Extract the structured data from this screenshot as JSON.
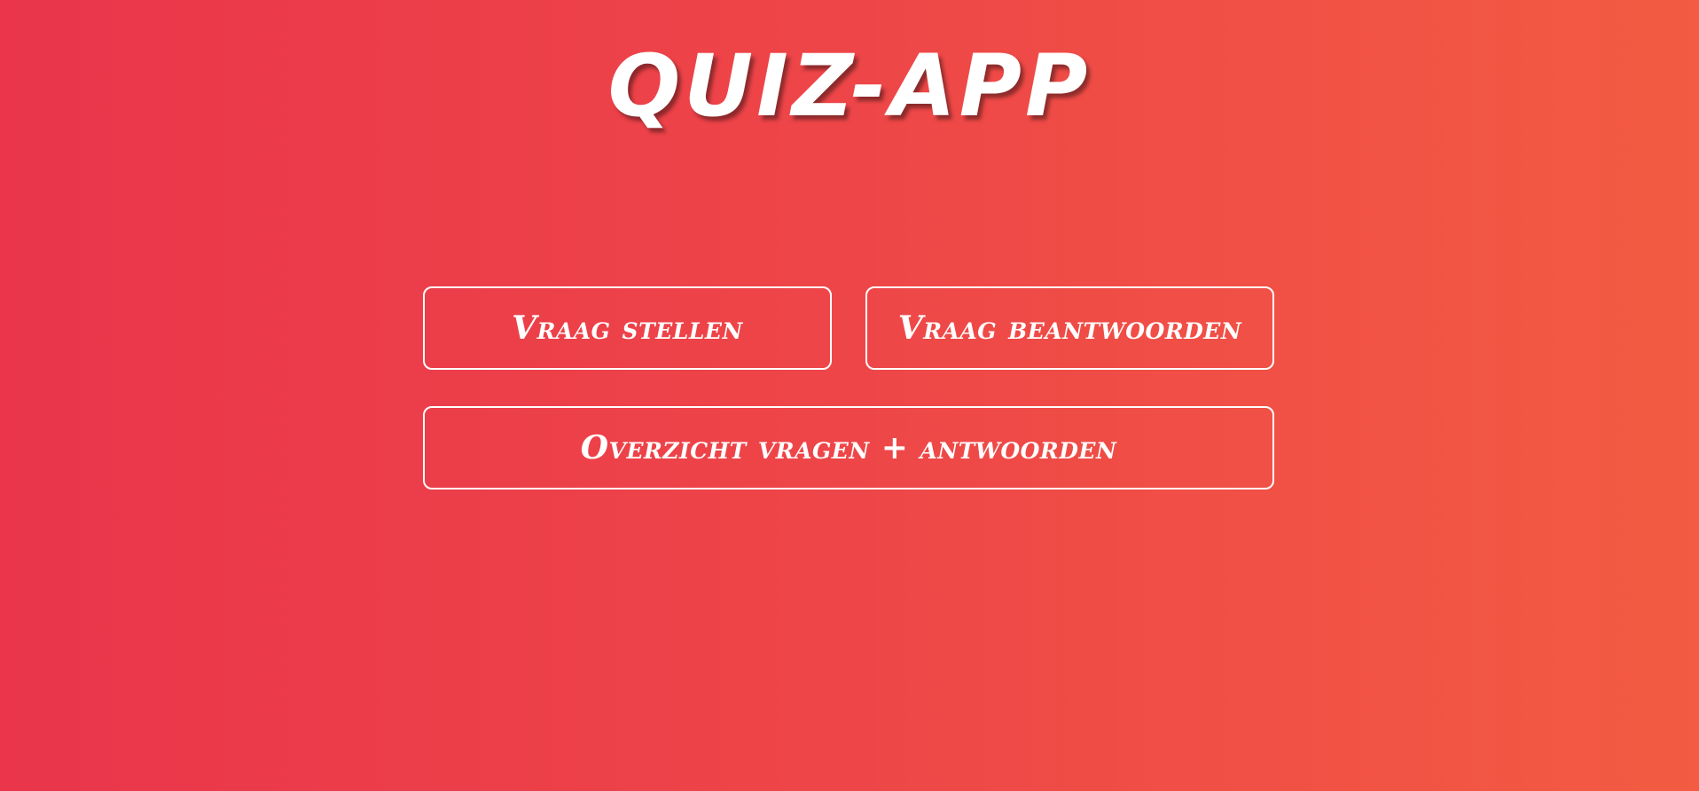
{
  "app": {
    "title": "QUIZ-APP"
  },
  "menu": {
    "ask_label": "Vraag stellen",
    "answer_label": "Vraag beantwoorden",
    "overview_label": "Overzicht vragen + antwoorden"
  },
  "colors": {
    "background_start": "#ea354b",
    "background_end": "#f35b42",
    "foreground": "#ffffff"
  }
}
